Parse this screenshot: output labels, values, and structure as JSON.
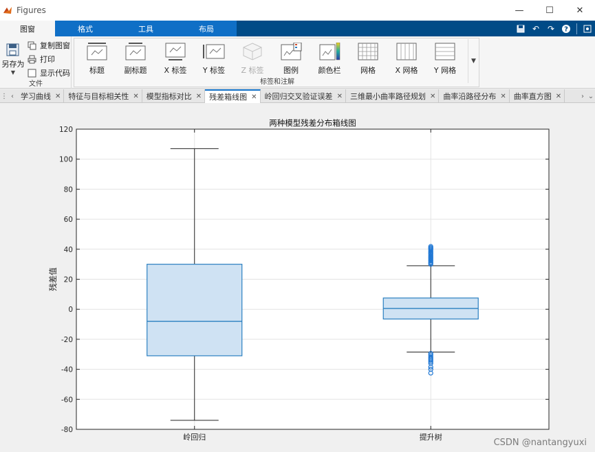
{
  "window": {
    "title": "Figures",
    "controls": {
      "minimize": "—",
      "maximize": "☐",
      "close": "✕"
    }
  },
  "ribbon": {
    "tabs": [
      "图窗",
      "格式",
      "工具",
      "布局"
    ],
    "active_tab": "图窗"
  },
  "toolstrip": {
    "file_group": {
      "label": "文件",
      "saveas": "另存为",
      "items": [
        "复制图窗",
        "打印",
        "显示代码"
      ]
    },
    "labels_group": {
      "label": "标签和注解",
      "tools": [
        "标题",
        "副标题",
        "X 标签",
        "Y 标签",
        "Z 标签",
        "图例",
        "颜色栏",
        "网格",
        "X 网格",
        "Y 网格"
      ],
      "disabled": [
        "Z 标签"
      ]
    }
  },
  "figure_tabs": {
    "tabs": [
      "学习曲线",
      "特征与目标相关性",
      "模型指标对比",
      "残差箱线图",
      "岭回归交叉验证误差",
      "三维最小曲率路径规划",
      "曲率沿路径分布",
      "曲率直方图"
    ],
    "active": "残差箱线图"
  },
  "colors": {
    "box_fill": "#cfe2f3",
    "box_edge": "#2a7fc0",
    "outlier": "#1f77d4",
    "whisker": "#222222",
    "grid": "#e3e3e3"
  },
  "chart_data": {
    "type": "boxplot",
    "title": "两种模型残差分布箱线图",
    "ylabel": "残差值",
    "xlabel": "",
    "ylim": [
      -80,
      120
    ],
    "yticks": [
      -80,
      -60,
      -40,
      -20,
      0,
      20,
      40,
      60,
      80,
      100,
      120
    ],
    "grid": true,
    "categories": [
      "岭回归",
      "提升树"
    ],
    "series": [
      {
        "category": "岭回归",
        "whisker_low": -74,
        "q1": -31,
        "median": -8,
        "q3": 30,
        "whisker_high": 107,
        "outliers": []
      },
      {
        "category": "提升树",
        "whisker_low": -28.5,
        "q1": -6.5,
        "median": 0.5,
        "q3": 7.5,
        "whisker_high": 29,
        "outliers": [
          30,
          30.8,
          31.5,
          32.3,
          33,
          33.8,
          34.5,
          35.3,
          36,
          36.8,
          37.5,
          38.3,
          39,
          39.8,
          40.5,
          41,
          41.8,
          -29.5,
          -30.5,
          -31.5,
          -32.5,
          -33.3,
          -34,
          -35,
          -36,
          -38.5,
          -40,
          -42.5
        ]
      }
    ]
  },
  "watermark": "CSDN @nantangyuxi"
}
